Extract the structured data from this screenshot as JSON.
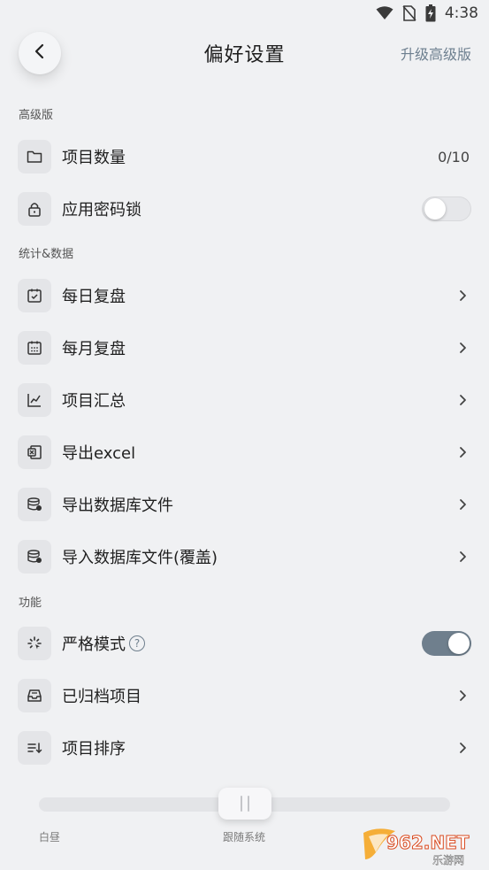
{
  "status_bar": {
    "time": "4:38",
    "icons": [
      "wifi-icon",
      "no-sim-icon",
      "battery-charging-icon"
    ]
  },
  "header": {
    "back_icon": "chevron-left-icon",
    "title": "偏好设置",
    "upgrade_label": "升级高级版"
  },
  "sections": {
    "premium": {
      "title": "高级版",
      "project_count": {
        "label": "项目数量",
        "value": "0/10",
        "icon": "folder-icon"
      },
      "app_lock": {
        "label": "应用密码锁",
        "icon": "lock-icon",
        "enabled": false
      }
    },
    "stats": {
      "title": "统计&数据",
      "daily_review": {
        "label": "每日复盘",
        "icon": "calendar-check-icon"
      },
      "monthly_review": {
        "label": "每月复盘",
        "icon": "calendar-grid-icon"
      },
      "project_summary": {
        "label": "项目汇总",
        "icon": "line-chart-icon"
      },
      "export_excel": {
        "label": "导出excel",
        "icon": "excel-icon"
      },
      "export_db": {
        "label": "导出数据库文件",
        "icon": "database-export-icon"
      },
      "import_db": {
        "label": "导入数据库文件(覆盖)",
        "icon": "database-import-icon"
      }
    },
    "features": {
      "title": "功能",
      "strict_mode": {
        "label": "严格模式",
        "help": "?",
        "icon": "loader-icon",
        "enabled": true
      },
      "archived_projects": {
        "label": "已归档项目",
        "icon": "archive-icon"
      },
      "project_sort": {
        "label": "项目排序",
        "icon": "sort-icon"
      }
    }
  },
  "theme_slider": {
    "left_label": "白昼",
    "middle_label": "跟随系统",
    "selected_index": 1,
    "position_count": 3
  },
  "watermark": {
    "brand": "962.NET",
    "subtitle": "乐游网"
  },
  "colors": {
    "background": "#f0f1f3",
    "accent": "#6f7f8d",
    "icon_box": "#e4e5e8"
  }
}
